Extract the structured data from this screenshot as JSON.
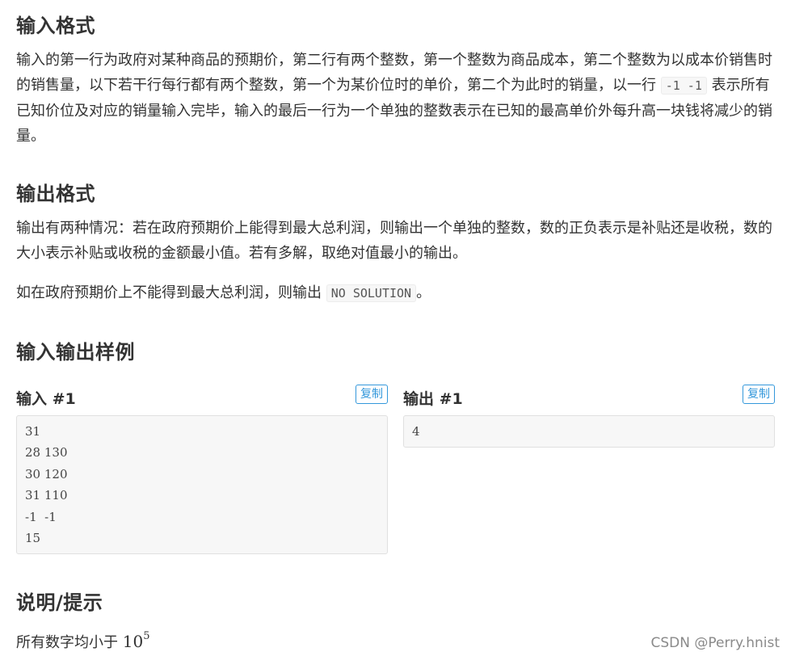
{
  "input_format": {
    "title": "输入格式",
    "text_a": "输入的第一行为政府对某种商品的预期价，第二行有两个整数，第一个整数为商品成本，第二个整数为以成本价销售时的销售量，以下若干行每行都有两个整数，第一个为某价位时的单价，第二个为此时的销量，以一行 ",
    "code": "-1 -1",
    "text_b": " 表示所有已知价位及对应的销量输入完毕，输入的最后一行为一个单独的整数表示在已知的最高单价外每升高一块钱将减少的销量。"
  },
  "output_format": {
    "title": "输出格式",
    "text1": "输出有两种情况：若在政府预期价上能得到最大总利润，则输出一个单独的整数，数的正负表示是补贴还是收税，数的大小表示补贴或收税的金额最小值。若有多解，取绝对值最小的输出。",
    "text2_a": "如在政府预期价上不能得到最大总利润，则输出 ",
    "code": "NO SOLUTION",
    "text2_b": "。"
  },
  "samples": {
    "title": "输入输出样例",
    "input": {
      "label": "输入 #1",
      "copy_label": "复制",
      "content": "31\n28 130\n30 120\n31 110\n-1  -1\n15"
    },
    "output": {
      "label": "输出 #1",
      "copy_label": "复制",
      "content": "4"
    }
  },
  "hint": {
    "title": "说明/提示",
    "text": "所有数字均小于 ",
    "math_base": "10",
    "math_exp": "5"
  },
  "watermark": "CSDN @Perry.hnist"
}
